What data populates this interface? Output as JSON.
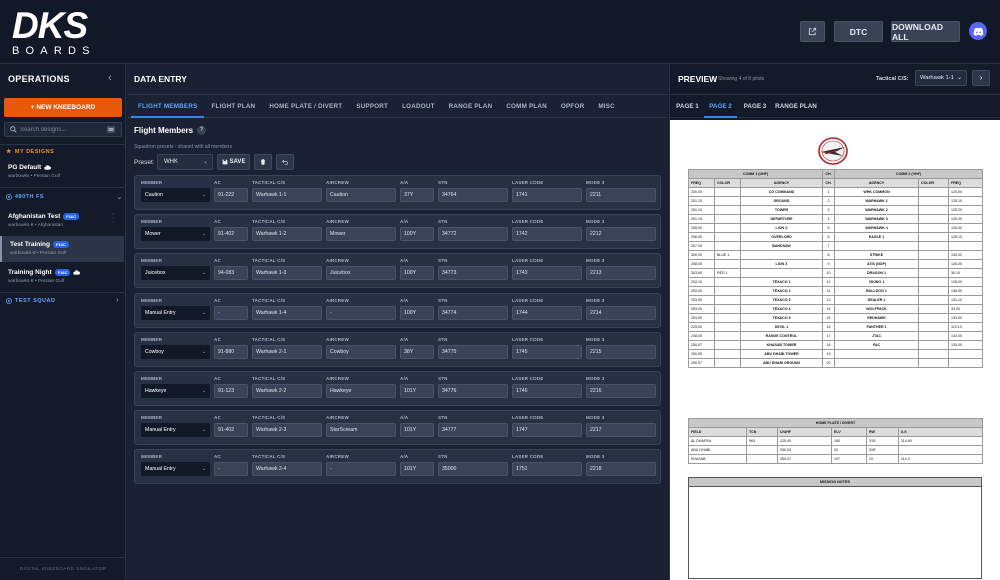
{
  "brand": {
    "top": "DKS",
    "bottom": "BOARDS"
  },
  "header": {
    "dtc_label": "DTC",
    "download_label": "DOWNLOAD ALL"
  },
  "sidebar": {
    "title": "OPERATIONS",
    "new_button": "+ NEW KNEEBOARD",
    "search_placeholder": "Search designs...",
    "sections": {
      "my_designs": "MY DESIGNS",
      "fs": "480TH FS",
      "squad": "TEST SQUAD"
    },
    "items": [
      {
        "name": "PG Default",
        "sub": "warbowks • Persian Gulf",
        "badge": ""
      },
      {
        "name": "Afghanistan Test",
        "sub": "warbowks-8 • Afghanistan",
        "badge": "F16C"
      },
      {
        "name": "Test Training",
        "sub": "warbowks-8 • Persian Gulf",
        "badge": "F16C"
      },
      {
        "name": "Training Night",
        "sub": "warbowks-8 • Persian Gulf",
        "badge": "F16C"
      }
    ],
    "footer": "DIGITAL KNEEBOARD SIMULATOR"
  },
  "data_entry": {
    "title": "DATA ENTRY",
    "tabs": [
      "FLIGHT MEMBERS",
      "FLIGHT PLAN",
      "HOME PLATE / DIVERT",
      "SUPPORT",
      "LOADOUT",
      "RANGE PLAN",
      "COMM PLAN",
      "OPFOR",
      "MISC"
    ],
    "section_title": "Flight Members",
    "section_sub": "Squadron presets - shared with all members",
    "preset_label": "Preset:",
    "preset_value": "WHK",
    "save_label": "SAVE",
    "labels": {
      "member": "MEMBER",
      "ac": "AC",
      "tcs": "TACTICAL C/S",
      "aircrew": "AIRCREW",
      "aa": "A/A",
      "stn": "STN",
      "laser": "LASER CODE",
      "mode3": "MODE 3"
    },
    "members": [
      {
        "member": "Caution",
        "ac": "91-222",
        "tcs": "Warhawk 1-1",
        "aircrew": "Caution",
        "aa": "37Y",
        "stn": "34764",
        "laser": "1741",
        "mode3": "2211"
      },
      {
        "member": "Mower",
        "ac": "91-402",
        "tcs": "Warhawk 1-2",
        "aircrew": "Mower",
        "aa": "100Y",
        "stn": "34772",
        "laser": "1742",
        "mode3": "2212"
      },
      {
        "member": "Juicebox",
        "ac": "94-083",
        "tcs": "Warhawk 1-3",
        "aircrew": "Juicebox",
        "aa": "100Y",
        "stn": "34773",
        "laser": "1743",
        "mode3": "2213"
      },
      {
        "member": "Manual Entry",
        "ac": "-",
        "tcs": "Warhawk 1-4",
        "aircrew": "-",
        "aa": "100Y",
        "stn": "34774",
        "laser": "1744",
        "mode3": "2214"
      },
      {
        "member": "Cowboy",
        "ac": "91-880",
        "tcs": "Warhawk 2-1",
        "aircrew": "Cowboy",
        "aa": "38Y",
        "stn": "34775",
        "laser": "1745",
        "mode3": "2215"
      },
      {
        "member": "Hawkeye",
        "ac": "91-123",
        "tcs": "Warhawk 2-2",
        "aircrew": "Hawkeye",
        "aa": "101Y",
        "stn": "34776",
        "laser": "1746",
        "mode3": "2216"
      },
      {
        "member": "Manual Entry",
        "ac": "91-402",
        "tcs": "Warhawk 2-3",
        "aircrew": "StarScream",
        "aa": "101Y",
        "stn": "34777",
        "laser": "1747",
        "mode3": "2217"
      },
      {
        "member": "Manual Entry",
        "ac": "-",
        "tcs": "Warhawk 2-4",
        "aircrew": "-",
        "aa": "101Y",
        "stn": "35000",
        "laser": "1751",
        "mode3": "2218"
      }
    ]
  },
  "preview": {
    "title": "PREVIEW",
    "showing": "Showing 4 of 8 pilots",
    "tcs_label": "Tactical C/S:",
    "tcs_value": "Warhawk 1-1",
    "tabs": [
      "PAGE 1",
      "PAGE 2",
      "PAGE 3",
      "RANGE PLAN"
    ],
    "comm": {
      "h1": "COMM 1 (UHF)",
      "hch": "CH.",
      "h2": "COMM 2 (VHF)",
      "sub": [
        "FREQ",
        "COLOR",
        "AGENCY",
        "CH.",
        "AGENCY",
        "COLOR",
        "FREQ"
      ],
      "rows": [
        [
          "230.00",
          "",
          "CG COMMAND",
          "1",
          "WHK COMMON",
          "",
          "125.00"
        ],
        [
          "251.15",
          "",
          "GROUND",
          "2",
          "WARHAWK 1",
          "",
          "125.10"
        ],
        [
          "251.10",
          "",
          "TOWER",
          "3",
          "WARHAWK 2",
          "",
          "125.20"
        ],
        [
          "251.15",
          "",
          "DEPARTURE",
          "4",
          "WARHAWK 3",
          "",
          "125.30"
        ],
        [
          "258.00",
          "",
          "LION X",
          "5",
          "WARHAWK 4",
          "",
          "125.40"
        ],
        [
          "256.00",
          "",
          "OVERLORD",
          "6",
          "EAGLE 1",
          "",
          "128.10"
        ],
        [
          "257.00",
          "",
          "BANDSAW",
          "7",
          "",
          "",
          ""
        ],
        [
          "300.90",
          "BLUE 1",
          "",
          "8",
          "STRIKE",
          "",
          "130.00"
        ],
        [
          "258.00",
          "",
          "LION X",
          "9",
          "ATIS (NOP)",
          "",
          "126.00"
        ],
        [
          "303.60",
          "RED 1",
          "",
          "10",
          "DRAGON 1",
          "",
          "30.10"
        ],
        [
          "253.10",
          "",
          "TEXACO 1",
          "11",
          "VIKING 1",
          "",
          "138.00"
        ],
        [
          "253.20",
          "",
          "TEXACO 2",
          "12",
          "BULLDOG 1",
          "",
          "136.00"
        ],
        [
          "253.30",
          "",
          "TEXACO 3",
          "13",
          "DEALER 1",
          "",
          "131.10"
        ],
        [
          "253.40",
          "",
          "TEXACO 4",
          "14",
          "WOLFPACK",
          "",
          "33.00"
        ],
        [
          "253.50",
          "",
          "TEXACO 5",
          "15",
          "REDHAWK",
          "",
          "133.00"
        ],
        [
          "225.00",
          "",
          "DEVIL 1",
          "16",
          "PANTHER 1",
          "",
          "119.10"
        ],
        [
          "248.00",
          "",
          "RANGE CONTROL",
          "17",
          "JTAC",
          "",
          "133.00"
        ],
        [
          "250.07",
          "",
          "KHASAB TOWER",
          "18",
          "FAC",
          "",
          "135.00"
        ],
        [
          "250.55",
          "",
          "ABU DHABI TOWER",
          "19",
          "",
          "",
          ""
        ],
        [
          "250.57",
          "",
          "ABU DHABI GROUND",
          "20",
          "",
          "",
          ""
        ]
      ]
    },
    "home_plate": {
      "title": "HOME PLATE / DIVERT",
      "cols": [
        "FIELD",
        "TCN",
        "U/UHF",
        "ELV",
        "RW",
        "ILS"
      ],
      "rows": [
        [
          "AL DHAFRA",
          "96X",
          "125.40",
          "180",
          "31R",
          "114.90"
        ],
        [
          "ABU DHABI",
          "",
          "250.53",
          "92",
          "31R",
          ""
        ],
        [
          "KHASAB",
          "",
          "250.07",
          "107",
          "19",
          "110.3"
        ]
      ]
    },
    "notes_title": "MISSION NOTES"
  },
  "colors": {
    "accent": "#e8590c",
    "tab_active": "#3b82f6",
    "badge": "#2563eb",
    "discord": "#5865f2"
  }
}
